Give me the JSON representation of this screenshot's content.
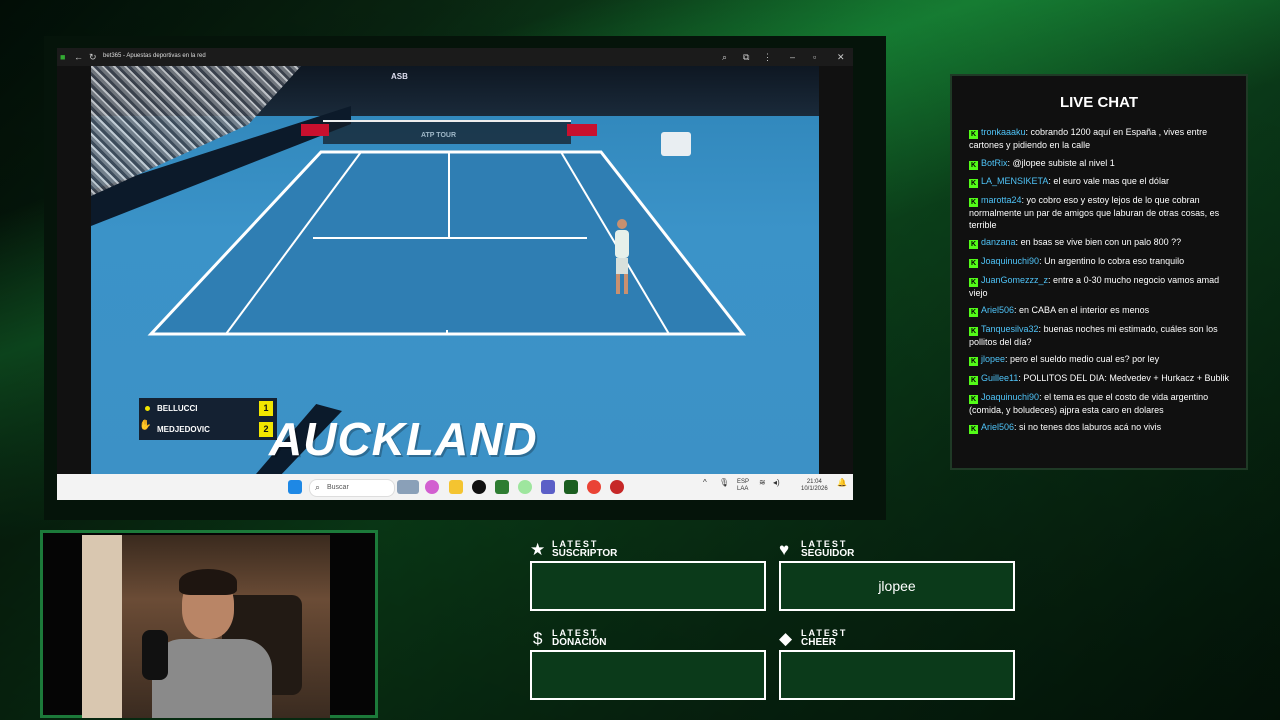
{
  "browser": {
    "title": "bet365 - Apuestas deportivas en la red",
    "taskbar_search_placeholder": "Buscar",
    "tray": {
      "lang_1": "ESP",
      "lang_2": "LAA",
      "time": "21:04",
      "date": "10/1/2026"
    }
  },
  "video": {
    "player1": {
      "name": "BELLUCCI",
      "score": "1"
    },
    "player2": {
      "name": "MEDJEDOVIC",
      "score": "2"
    },
    "venue": "AUCKLAND",
    "ad_text": "ASB",
    "tour": "ATP TOUR"
  },
  "chat": {
    "title": "LIVE CHAT",
    "badge": "K",
    "messages": [
      {
        "user": "tronkaaaku",
        "text": "cobrando 1200 aquí en España , vives entre cartones y pidiendo en la calle"
      },
      {
        "user": "BotRix",
        "text": "@jlopee subiste al nivel 1"
      },
      {
        "user": "LA_MENSIKETA",
        "text": "el euro vale mas que el dólar"
      },
      {
        "user": "marotta24",
        "text": "yo cobro eso y estoy lejos de lo que cobran normalmente un par de amigos que laburan de otras cosas, es terrible"
      },
      {
        "user": "danzana",
        "text": "en bsas se vive bien con un palo 800 ??"
      },
      {
        "user": "Joaquinuchi90",
        "text": "Un argentino lo cobra eso tranquilo"
      },
      {
        "user": "JuanGomezzz_z",
        "text": "entre a 0-30 mucho negocio vamos amad viejo"
      },
      {
        "user": "Ariel506",
        "text": "en CABA en el interior es menos"
      },
      {
        "user": "Tanquesilva32",
        "text": "buenas noches mi estimado, cuáles son los pollitos del día?"
      },
      {
        "user": "jlopee",
        "text": "pero el sueldo medio cual es? por ley"
      },
      {
        "user": "Guillee11",
        "text": "POLLITOS DEL DIA: Medvedev + Hurkacz + Bublik"
      },
      {
        "user": "Joaquinuchi90",
        "text": "el tema es que el costo de vida argentino (comida, y boludeces) ajpra esta caro en dolares"
      },
      {
        "user": "Ariel506",
        "text": "si no tenes dos laburos acá no vivis"
      }
    ]
  },
  "alerts": {
    "suscriptor": {
      "top": "LATEST",
      "bottom": "SUSCRIPTOR",
      "value": ""
    },
    "seguidor": {
      "top": "LATEST",
      "bottom": "SEGUIDOR",
      "value": "jlopee"
    },
    "donacion": {
      "top": "LATEST",
      "bottom": "DONACIÓN",
      "value": ""
    },
    "cheer": {
      "top": "LATEST",
      "bottom": "CHEER",
      "value": ""
    }
  }
}
